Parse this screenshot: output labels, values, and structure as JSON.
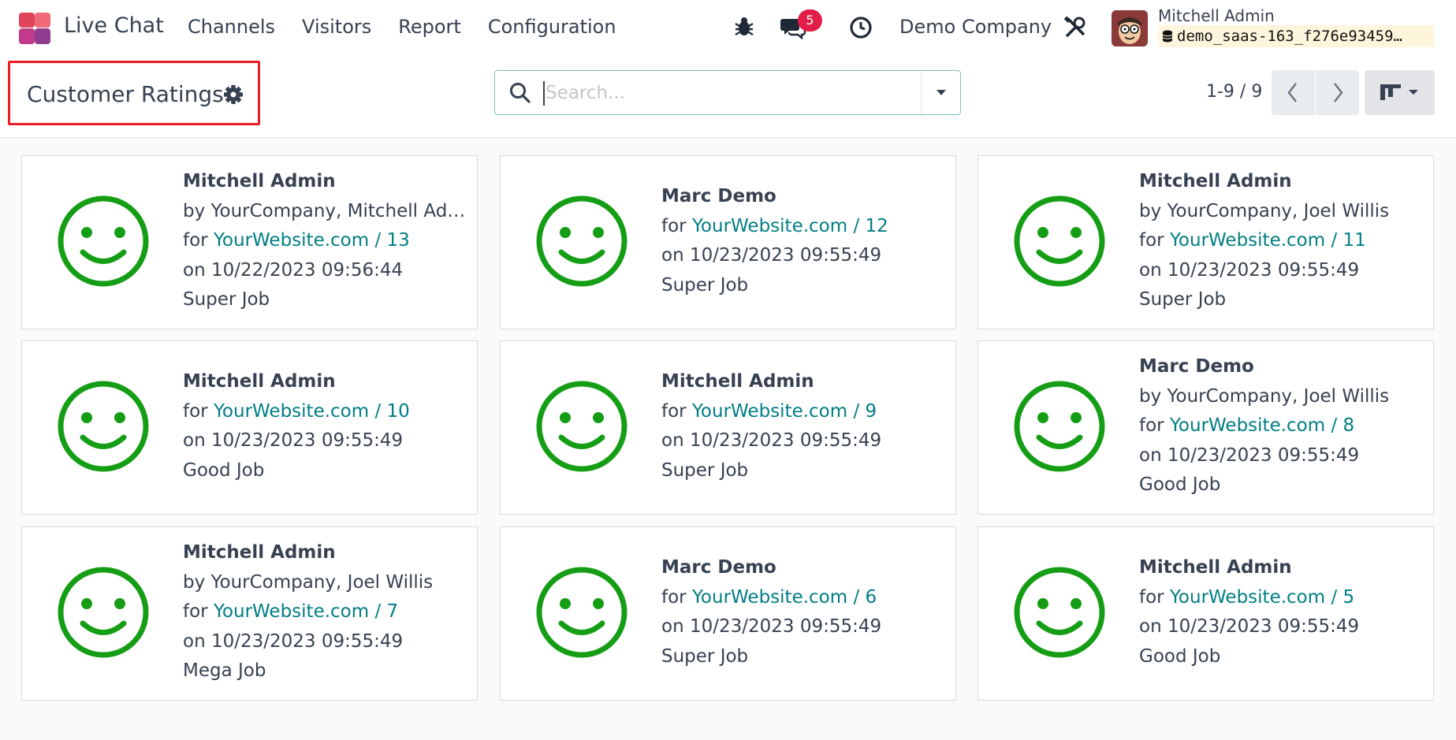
{
  "navbar": {
    "app_title": "Live Chat",
    "menu": [
      "Channels",
      "Visitors",
      "Report",
      "Configuration"
    ],
    "chat_badge": "5",
    "company": "Demo Company",
    "user_name": "Mitchell Admin",
    "database": "demo_saas-163_f276e93459…",
    "icons": [
      "app-logo-icon",
      "bug-icon",
      "chat-icon",
      "clock-icon",
      "tools-icon",
      "database-icon"
    ]
  },
  "control_panel": {
    "title": "Customer Ratings",
    "search_placeholder": "Search...",
    "pager": "1-9 / 9"
  },
  "colors": {
    "smiley": "#159e15",
    "link": "#017e84",
    "highlight_border": "#ed1c24",
    "badge": "#e11d48"
  },
  "ratings": [
    {
      "name": "Mitchell Admin",
      "by": "by YourCompany, Mitchell Ad…",
      "for_prefix": "for ",
      "record": "YourWebsite.com / 13",
      "date": "on 10/22/2023 09:56:44",
      "comment": "Super Job"
    },
    {
      "name": "Marc Demo",
      "by": "",
      "for_prefix": "for ",
      "record": "YourWebsite.com / 12",
      "date": "on 10/23/2023 09:55:49",
      "comment": "Super Job"
    },
    {
      "name": "Mitchell Admin",
      "by": "by YourCompany, Joel Willis",
      "for_prefix": "for ",
      "record": "YourWebsite.com / 11",
      "date": "on 10/23/2023 09:55:49",
      "comment": "Super Job"
    },
    {
      "name": "Mitchell Admin",
      "by": "",
      "for_prefix": "for ",
      "record": "YourWebsite.com / 10",
      "date": "on 10/23/2023 09:55:49",
      "comment": "Good Job"
    },
    {
      "name": "Mitchell Admin",
      "by": "",
      "for_prefix": "for ",
      "record": "YourWebsite.com / 9",
      "date": "on 10/23/2023 09:55:49",
      "comment": "Super Job"
    },
    {
      "name": "Marc Demo",
      "by": "by YourCompany, Joel Willis",
      "for_prefix": "for ",
      "record": "YourWebsite.com / 8",
      "date": "on 10/23/2023 09:55:49",
      "comment": "Good Job"
    },
    {
      "name": "Mitchell Admin",
      "by": "by YourCompany, Joel Willis",
      "for_prefix": "for ",
      "record": "YourWebsite.com / 7",
      "date": "on 10/23/2023 09:55:49",
      "comment": "Mega Job"
    },
    {
      "name": "Marc Demo",
      "by": "",
      "for_prefix": "for ",
      "record": "YourWebsite.com / 6",
      "date": "on 10/23/2023 09:55:49",
      "comment": "Super Job"
    },
    {
      "name": "Mitchell Admin",
      "by": "",
      "for_prefix": "for ",
      "record": "YourWebsite.com / 5",
      "date": "on 10/23/2023 09:55:49",
      "comment": "Good Job"
    }
  ]
}
